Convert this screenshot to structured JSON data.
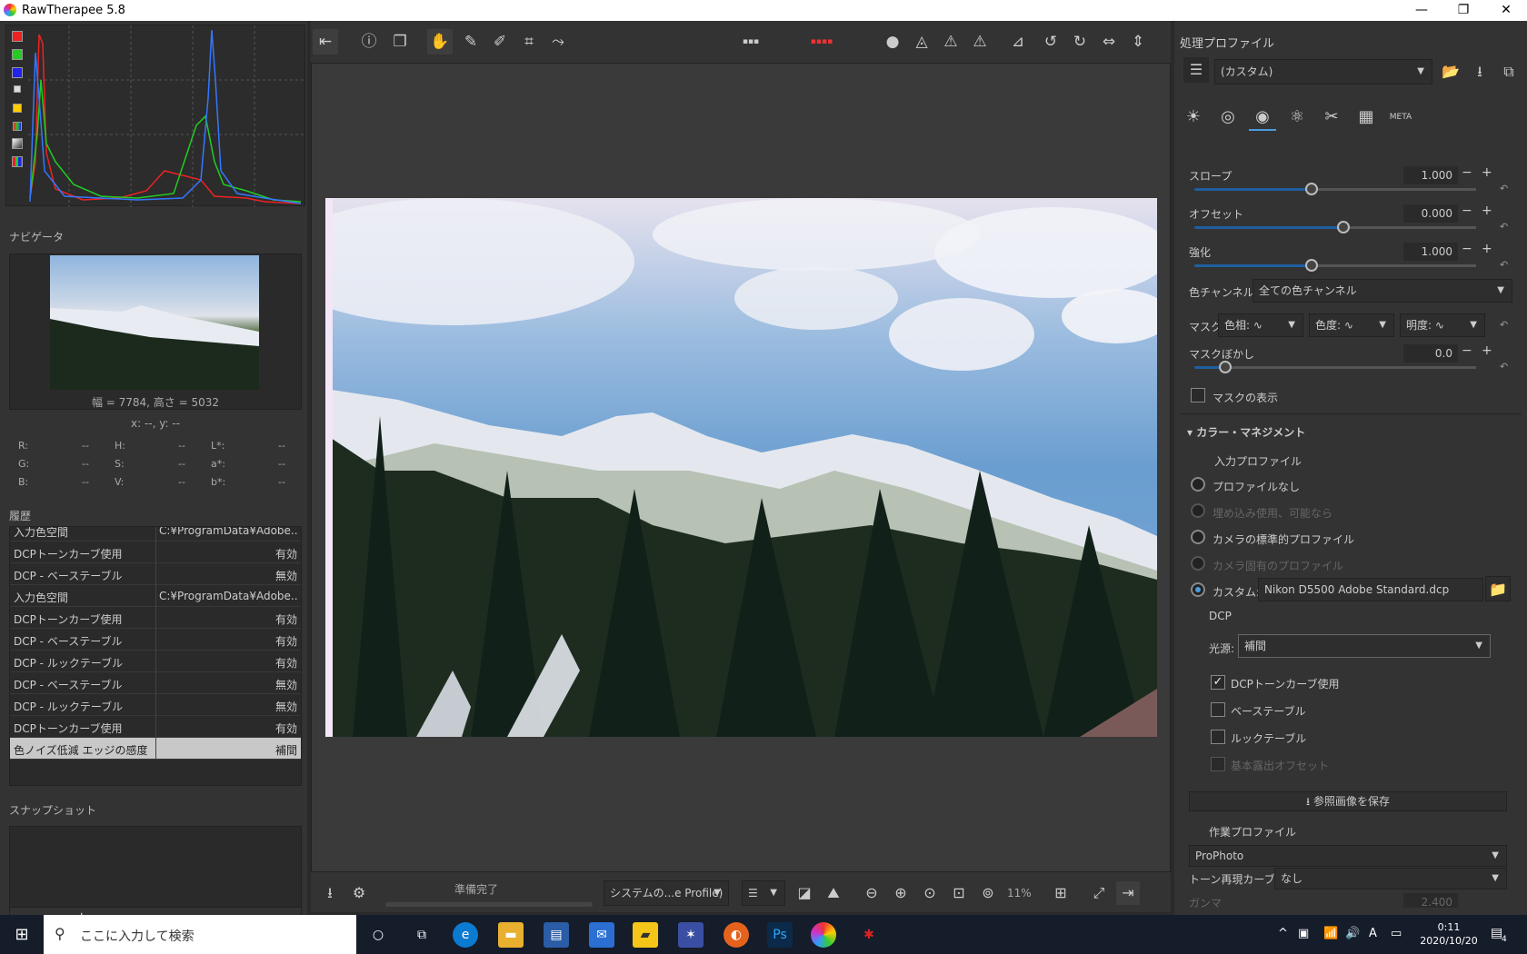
{
  "window": {
    "title": "RawTherapee 5.8",
    "minimize": "—",
    "maximize": "❐",
    "close": "✕"
  },
  "histogram_buttons": [
    "red-channel-icon",
    "green-channel-icon",
    "blue-channel-icon",
    "luminance-icon",
    "chroma-icon",
    "rgb-icon",
    "raw-icon",
    "mode-icon"
  ],
  "navigator": {
    "label": "ナビゲータ",
    "size_text": "幅 = 7784, 高さ = 5032",
    "coords_text": "x: --, y: --",
    "readouts": [
      {
        "k": "R:",
        "v": "--"
      },
      {
        "k": "H:",
        "v": "--"
      },
      {
        "k": "L*:",
        "v": "--"
      },
      {
        "k": "G:",
        "v": "--"
      },
      {
        "k": "S:",
        "v": "--"
      },
      {
        "k": "a*:",
        "v": "--"
      },
      {
        "k": "B:",
        "v": "--"
      },
      {
        "k": "V:",
        "v": "--"
      },
      {
        "k": "b*:",
        "v": "--"
      }
    ]
  },
  "history": {
    "label": "履歴",
    "rows": [
      {
        "action": "入力色空間",
        "value": "C:¥ProgramData¥Adobe..."
      },
      {
        "action": "DCPトーンカーブ使用",
        "value": "有効"
      },
      {
        "action": "DCP - ベーステーブル",
        "value": "無効"
      },
      {
        "action": "入力色空間",
        "value": "C:¥ProgramData¥Adobe..."
      },
      {
        "action": "DCPトーンカーブ使用",
        "value": "有効"
      },
      {
        "action": "DCP - ベーステーブル",
        "value": "有効"
      },
      {
        "action": "DCP - ルックテーブル",
        "value": "有効"
      },
      {
        "action": "DCP - ベーステーブル",
        "value": "無効"
      },
      {
        "action": "DCP - ルックテーブル",
        "value": "無効"
      },
      {
        "action": "DCPトーンカーブ使用",
        "value": "有効"
      },
      {
        "action": "色ノイズ低減 エッジの感度",
        "value": "補間"
      }
    ]
  },
  "snapshot": {
    "label": "スナップショット",
    "add": "+",
    "remove": "−"
  },
  "bottom": {
    "status": "準備完了",
    "profile_combo": "システムの...e Profile)",
    "zoom": "11%"
  },
  "right": {
    "profile_label": "処理プロファイル",
    "profile_value": "(カスタム)",
    "params": [
      {
        "label": "スロープ",
        "value": "1.000",
        "pos": 0.5
      },
      {
        "label": "オフセット",
        "value": "0.000",
        "pos": 0.5
      },
      {
        "label": "強化",
        "value": "1.000",
        "pos": 0.3
      }
    ],
    "color_channel_label": "色チャンネル:",
    "color_channel_value": "全ての色チャンネル",
    "mask_label": "マスク:",
    "mask_hue": "色相:",
    "mask_chroma": "色度:",
    "mask_light": "明度:",
    "mask_blur_label": "マスクぼかし",
    "mask_blur_value": "0.0",
    "show_mask": "マスクの表示",
    "color_mgmt": "カラー・マネジメント",
    "input_profile": "入力プロファイル",
    "opt_none": "プロファイルなし",
    "opt_embedded": "埋め込み使用、可能なら",
    "opt_camera_std": "カメラの標準的プロファイル",
    "opt_camera_specific": "カメラ固有のプロファイル",
    "opt_custom": "カスタム:",
    "custom_file": "Nikon D5500 Adobe Standard.dcp",
    "dcp_label": "DCP",
    "illuminant_label": "光源:",
    "illuminant_value": "補間",
    "cb_tone": "DCPトーンカーブ使用",
    "cb_base": "ベーステーブル",
    "cb_look": "ルックテーブル",
    "cb_exposure": "基本露出オフセット",
    "save_ref": "参照画像を保存",
    "working_profile": "作業プロファイル",
    "working_value": "ProPhoto",
    "tone_curve_label": "トーン再現カーブ:",
    "tone_curve_value": "なし",
    "gamma_label": "ガンマ",
    "gamma_value": "2.400"
  },
  "taskbar": {
    "search_placeholder": "ここに入力して検索",
    "time": "0:11",
    "date": "2020/10/20",
    "notif_count": "4",
    "ime": "A"
  }
}
